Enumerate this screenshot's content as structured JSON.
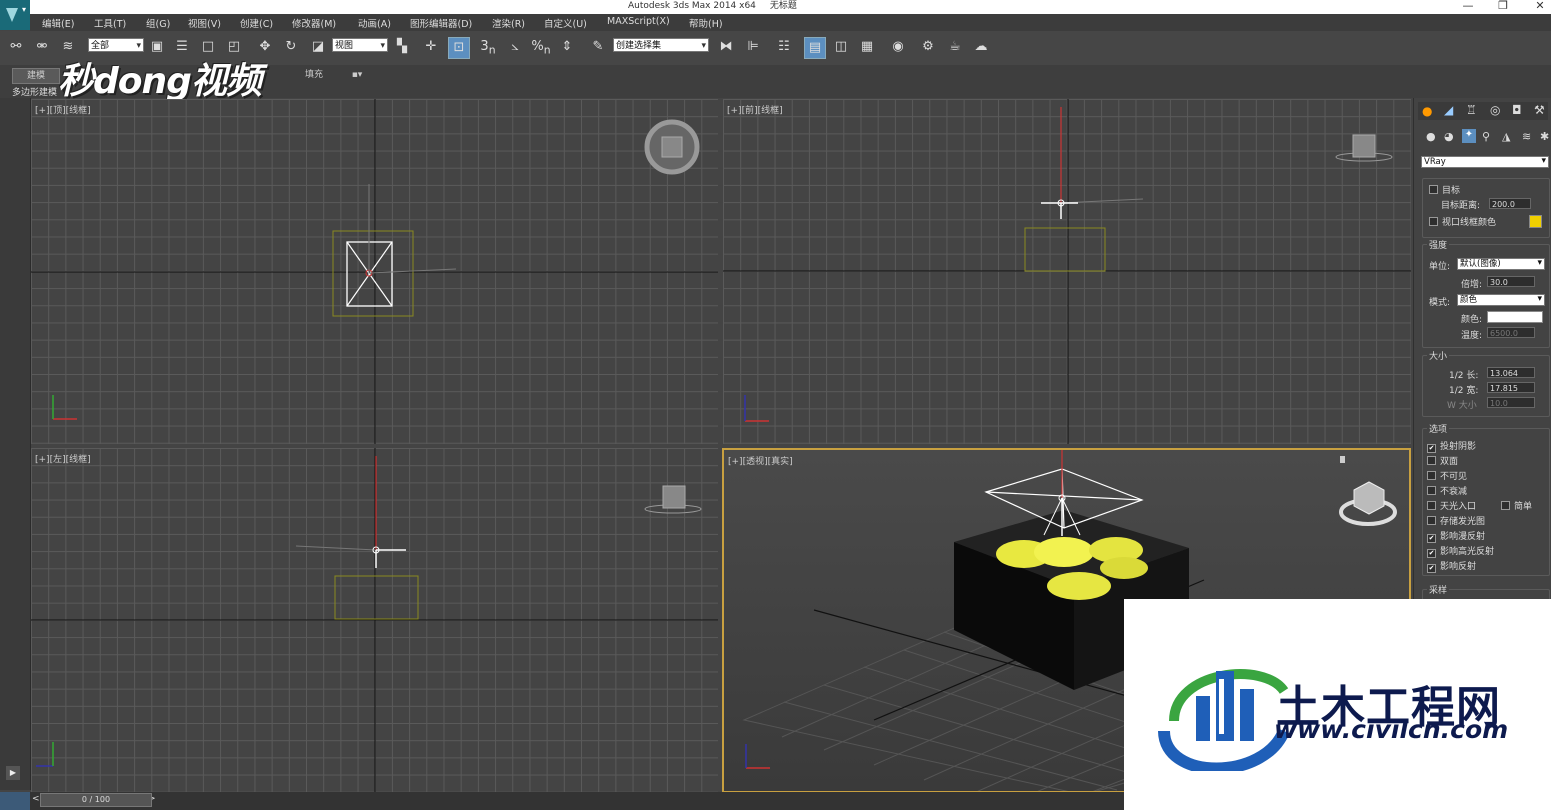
{
  "window": {
    "app_title": "Autodesk 3ds Max  2014 x64",
    "doc_title": "无标题",
    "minimize": "—",
    "maximize": "❐",
    "close": "✕"
  },
  "menu": [
    "编辑(E)",
    "工具(T)",
    "组(G)",
    "视图(V)",
    "创建(C)",
    "修改器(M)",
    "动画(A)",
    "图形编辑器(D)",
    "渲染(R)",
    "自定义(U)",
    "MAXScript(X)",
    "帮助(H)"
  ],
  "toolbar": {
    "selection_filter": "全部",
    "reference_coord": "视图",
    "named_selection": "创建选择集",
    "snap_label_3": "3",
    "snap_label_percent": "%"
  },
  "ribbon": {
    "tab_modeling": "建模",
    "tab_fill": "填充",
    "sub_label": "多边形建模"
  },
  "watermark": "秒dong视频",
  "viewports": [
    {
      "label": "[+][顶][线框]"
    },
    {
      "label": "[+][前][线框]"
    },
    {
      "label": "[+][左][线框]"
    },
    {
      "label": "[+][透视][真实]"
    }
  ],
  "panel": {
    "renderer": "VRay",
    "target_checkbox": "目标",
    "target_distance_label": "目标距离:",
    "target_distance_value": "200.0",
    "viewport_wire_color": "视口线框颜色",
    "wire_color": "#f0d000",
    "intensity_group": "强度",
    "units_label": "单位:",
    "units_value": "默认(图像)",
    "multiplier_label": "倍增:",
    "multiplier_value": "30.0",
    "mode_label": "模式:",
    "mode_value": "颜色",
    "color_label": "颜色:",
    "light_color": "#ffffff",
    "temperature_label": "温度:",
    "temperature_value": "6500.0",
    "size_group": "大小",
    "half_length_label": "1/2 长:",
    "half_length_value": "13.064",
    "half_width_label": "1/2 宽:",
    "half_width_value": "17.815",
    "w_size_label": "W 大小",
    "w_size_value": "10.0",
    "options_group": "选项",
    "options": [
      {
        "label": "投射阴影",
        "checked": true
      },
      {
        "label": "双面",
        "checked": false
      },
      {
        "label": "不可见",
        "checked": false
      },
      {
        "label": "不衰减",
        "checked": false
      },
      {
        "label": "天光入口",
        "checked": false
      },
      {
        "label": "存储发光图",
        "checked": false
      },
      {
        "label": "影响漫反射",
        "checked": true
      },
      {
        "label": "影响高光反射",
        "checked": true
      },
      {
        "label": "影响反射",
        "checked": true
      }
    ],
    "simple_label": "简单",
    "sampling_group": "采样"
  },
  "timeline": {
    "frame": "0 / 100",
    "prev": "<",
    "next": ">"
  },
  "logo": {
    "cn": "土木工程网",
    "en": "www.civilcn.com"
  }
}
